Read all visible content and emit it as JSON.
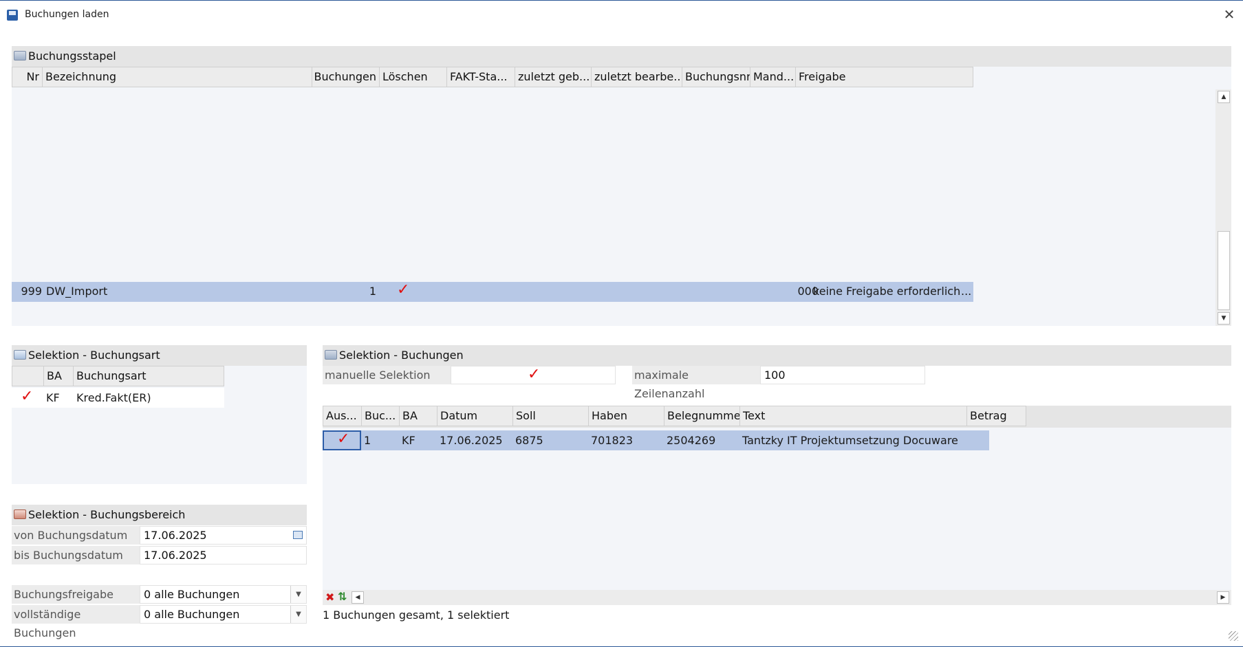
{
  "window": {
    "title": "Buchungen laden",
    "close_glyph": "✕"
  },
  "stapel": {
    "title": "Buchungsstapel",
    "columns": [
      "Nr",
      "Bezeichnung",
      "Buchungen",
      "Löschen",
      "FAKT-Sta...",
      "zuletzt geb...",
      "zuletzt bearbe...",
      "Buchungsnr",
      "Mand...",
      "Freigabe"
    ],
    "row": {
      "nr": "999",
      "bezeichnung": "DW_Import",
      "buchungen": "1",
      "loeschen_check": "✓",
      "mand": "000",
      "freigabe": "keine Freigabe erforderlich",
      "more": "..."
    }
  },
  "buchungsart": {
    "title": "Selektion - Buchungsart",
    "columns": [
      "",
      "BA",
      "Buchungsart"
    ],
    "row": {
      "check": "✓",
      "ba": "KF",
      "buchungsart": "Kred.Fakt(ER)"
    }
  },
  "bereich": {
    "title": "Selektion - Buchungsbereich",
    "von_label": "von Buchungsdatum",
    "von_value": "17.06.2025",
    "bis_label": "bis Buchungsdatum",
    "bis_value": "17.06.2025",
    "freigabe_label": "Buchungsfreigabe",
    "freigabe_value": "0 alle Buchungen",
    "vollstaendig_label": "vollständige Buchungen",
    "vollstaendig_value": "0 alle Buchungen"
  },
  "buchungen": {
    "title": "Selektion - Buchungen",
    "manuell_label": "manuelle Selektion",
    "manuell_check": "✓",
    "max_label": "maximale Zeilenanzahl",
    "max_value": "100",
    "columns": [
      "Aus...",
      "Buc...",
      "BA",
      "Datum",
      "Soll",
      "Haben",
      "Belegnummer",
      "Text",
      "Betrag"
    ],
    "row": {
      "check": "✓",
      "buc": "1",
      "ba": "KF",
      "datum": "17.06.2025",
      "soll": "6875",
      "haben": "701823",
      "belegnummer": "2504269",
      "text": "Tantzky IT Projektumsetzung Docuware"
    },
    "status": "1 Buchungen gesamt, 1 selektiert"
  },
  "icons": {
    "delete": "delete-icon",
    "sort": "sort-icon",
    "calendar": "calendar-icon"
  },
  "colors": {
    "selection": "#b7c8e6",
    "accent_check": "#e01010",
    "title_border": "#2b5797"
  }
}
